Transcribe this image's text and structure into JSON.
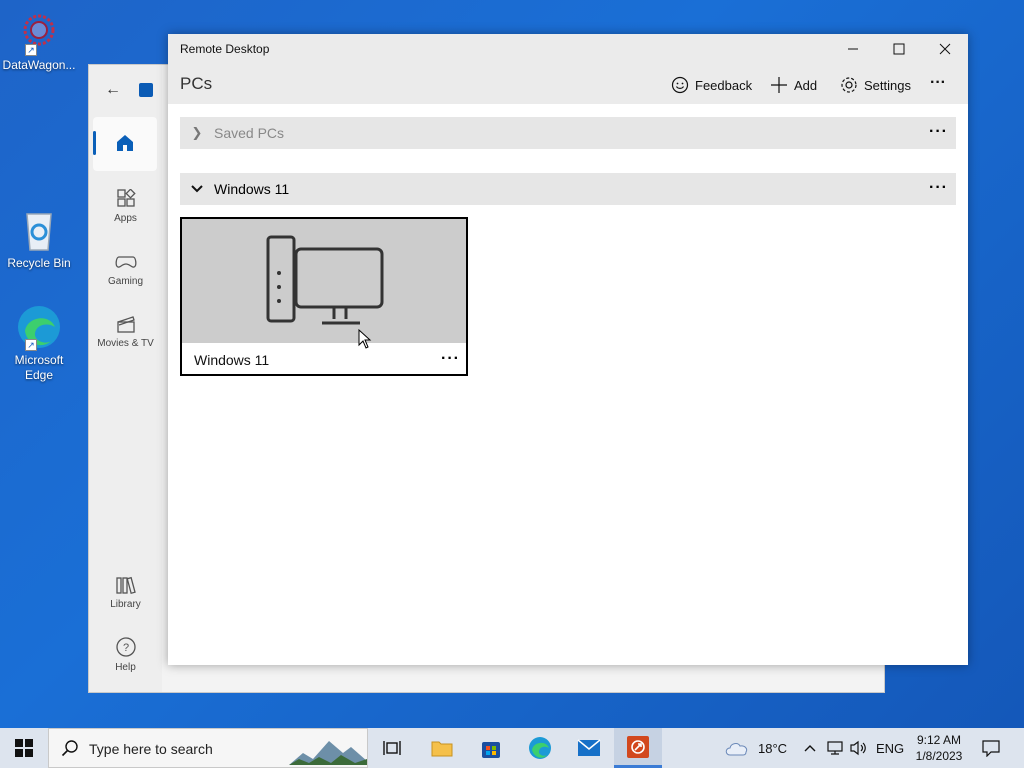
{
  "desktop": {
    "icons": [
      {
        "label": "DataWagon..."
      },
      {
        "label": "Recycle Bin"
      },
      {
        "label": "Microsoft Edge"
      }
    ]
  },
  "store": {
    "rail": [
      {
        "label": "Apps"
      },
      {
        "label": "Gaming"
      },
      {
        "label": "Movies & TV"
      },
      {
        "label": "Library"
      },
      {
        "label": "Help"
      }
    ]
  },
  "remote_desktop": {
    "window_title": "Remote Desktop",
    "heading": "PCs",
    "toolbar": {
      "feedback": "Feedback",
      "add": "Add",
      "settings": "Settings",
      "more": "···"
    },
    "groups": [
      {
        "label": "Saved PCs",
        "expanded": false
      },
      {
        "label": "Windows 11",
        "expanded": true
      }
    ],
    "tiles": [
      {
        "label": "Windows 11"
      }
    ]
  },
  "taskbar": {
    "search_placeholder": "Type here to search",
    "weather": "18°C",
    "language": "ENG",
    "time": "9:12 AM",
    "date": "1/8/2023"
  },
  "colors": {
    "desktop_blue": "#1a6fd6",
    "accent": "#0a5fb8"
  }
}
